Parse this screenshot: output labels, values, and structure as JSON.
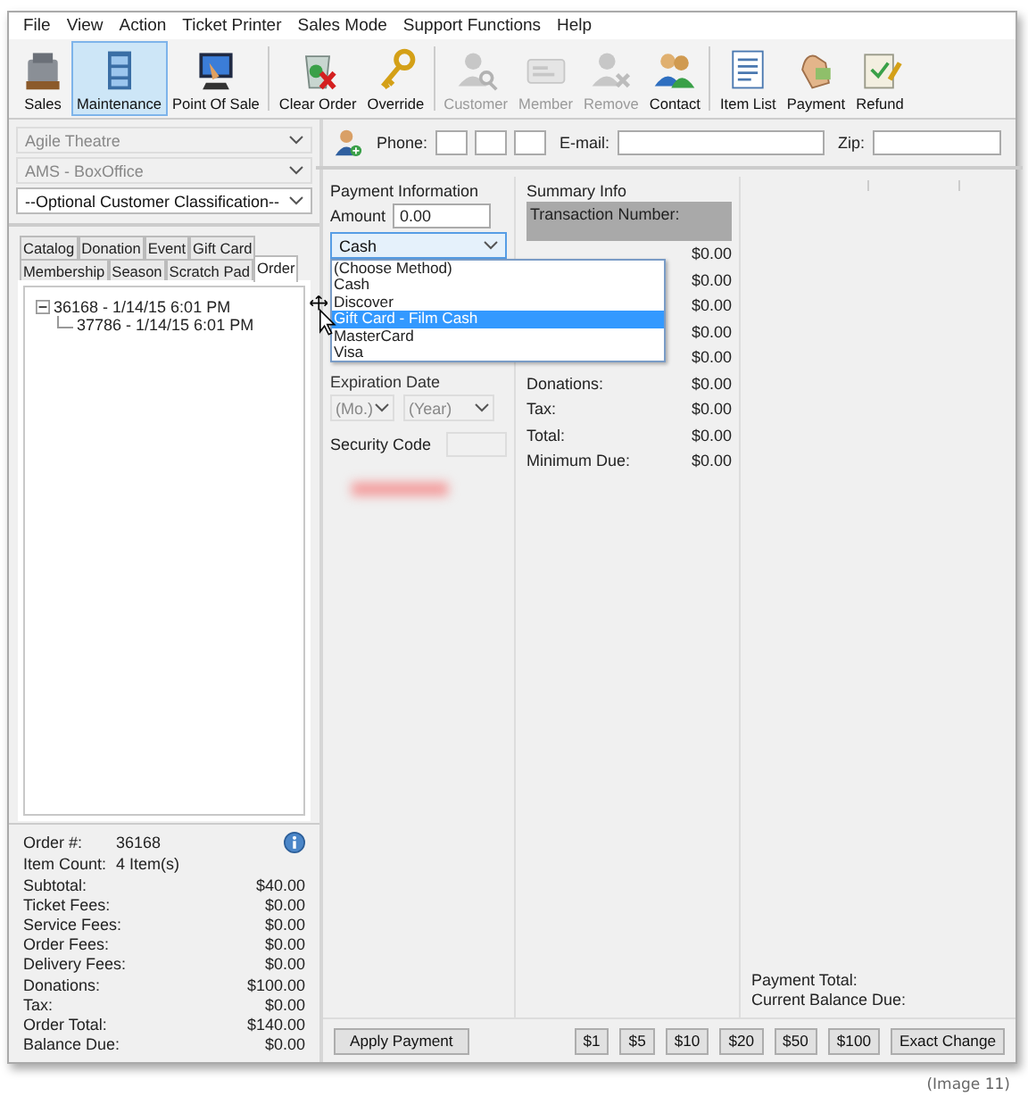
{
  "menu": [
    "File",
    "View",
    "Action",
    "Ticket Printer",
    "Sales Mode",
    "Support Functions",
    "Help"
  ],
  "toolbar_groups": [
    [
      {
        "label": "Sales",
        "kind": "register",
        "selected": false,
        "disabled": false
      },
      {
        "label": "Maintenance",
        "kind": "cabinet",
        "selected": true,
        "disabled": false
      },
      {
        "label": "Point Of Sale",
        "kind": "monitor",
        "selected": false,
        "disabled": false
      }
    ],
    [
      {
        "label": "Clear Order",
        "kind": "trash",
        "selected": false,
        "disabled": false
      },
      {
        "label": "Override",
        "kind": "key",
        "selected": false,
        "disabled": false
      }
    ],
    [
      {
        "label": "Customer",
        "kind": "person-search",
        "selected": false,
        "disabled": true
      },
      {
        "label": "Member",
        "kind": "card",
        "selected": false,
        "disabled": true
      },
      {
        "label": "Remove",
        "kind": "person-remove",
        "selected": false,
        "disabled": true
      },
      {
        "label": "Contact",
        "kind": "people",
        "selected": false,
        "disabled": false
      }
    ],
    [
      {
        "label": "Item List",
        "kind": "list",
        "selected": false,
        "disabled": false
      },
      {
        "label": "Payment",
        "kind": "hand",
        "selected": false,
        "disabled": false
      },
      {
        "label": "Refund",
        "kind": "refund",
        "selected": false,
        "disabled": false
      }
    ]
  ],
  "selectors": [
    {
      "value": "Agile Theatre",
      "disabled": true
    },
    {
      "value": "AMS - BoxOffice",
      "disabled": true
    },
    {
      "value": "--Optional Customer Classification--",
      "disabled": false
    }
  ],
  "tab_rows": [
    [
      {
        "label": "Catalog",
        "selected": false
      },
      {
        "label": "Donation",
        "selected": false
      },
      {
        "label": "Event",
        "selected": false
      },
      {
        "label": "Gift Card",
        "selected": false
      }
    ],
    [
      {
        "label": "Membership",
        "selected": false
      },
      {
        "label": "Season",
        "selected": false
      },
      {
        "label": "Scratch Pad",
        "selected": false
      },
      {
        "label": "Order",
        "selected": true
      }
    ]
  ],
  "tree": [
    {
      "label": "36168 - 1/14/15 6:01 PM",
      "expanded": true,
      "children": [
        {
          "label": "37786 - 1/14/15 6:01 PM"
        }
      ]
    }
  ],
  "order_summary": {
    "order_number": {
      "label": "Order #:",
      "value": "36168"
    },
    "item_count": {
      "label": "Item Count:",
      "value": "4 Item(s)"
    },
    "rows": [
      {
        "label": "Subtotal:",
        "value": "$40.00"
      },
      {
        "label": "Ticket Fees:",
        "value": "$0.00"
      },
      {
        "label": "Service Fees:",
        "value": "$0.00"
      },
      {
        "label": "Order Fees:",
        "value": "$0.00"
      },
      {
        "label": "Delivery Fees:",
        "value": "$0.00"
      },
      {
        "label": "Donations:",
        "value": "$100.00"
      },
      {
        "label": "Tax:",
        "value": "$0.00"
      },
      {
        "label": "Order Total:",
        "value": "$140.00"
      },
      {
        "label": "Balance Due:",
        "value": "$0.00"
      }
    ]
  },
  "customer": {
    "phone_label": "Phone:",
    "email_label": "E-mail:",
    "zip_label": "Zip:"
  },
  "payment": {
    "title": "Payment Information",
    "amount_label": "Amount",
    "amount_value": "0.00",
    "method": "Cash",
    "dropdown_open": true,
    "options": [
      {
        "label": "(Choose Method)",
        "selected": false
      },
      {
        "label": "Cash",
        "selected": false
      },
      {
        "label": "Discover",
        "selected": false
      },
      {
        "label": "Gift Card - Film Cash",
        "selected": true
      },
      {
        "label": "MasterCard",
        "selected": false
      },
      {
        "label": "Visa",
        "selected": false
      }
    ],
    "expiration_label": "Expiration Date",
    "month_placeholder": "(Mo.)",
    "year_placeholder": "(Year)",
    "security_label": "Security Code"
  },
  "summary": {
    "title": "Summary Info",
    "transaction_label": "Transaction Number:",
    "rows": [
      {
        "value": "$0.00"
      },
      {
        "value": "$0.00"
      },
      {
        "value": "$0.00"
      },
      {
        "value": "$0.00"
      },
      {
        "value": "$0.00"
      },
      {
        "label": "Donations:",
        "value": "$0.00"
      },
      {
        "label": "Tax:",
        "value": "$0.00"
      },
      {
        "label": "Total:",
        "value": "$0.00"
      },
      {
        "label": "Minimum Due:",
        "value": "$0.00"
      }
    ]
  },
  "totals": [
    "Payment Total:",
    "Current Balance Due:"
  ],
  "apply_button": "Apply Payment",
  "quick_buttons": [
    "$1",
    "$5",
    "$10",
    "$20",
    "$50",
    "$100",
    "Exact Change"
  ],
  "caption": "(Image 11)"
}
